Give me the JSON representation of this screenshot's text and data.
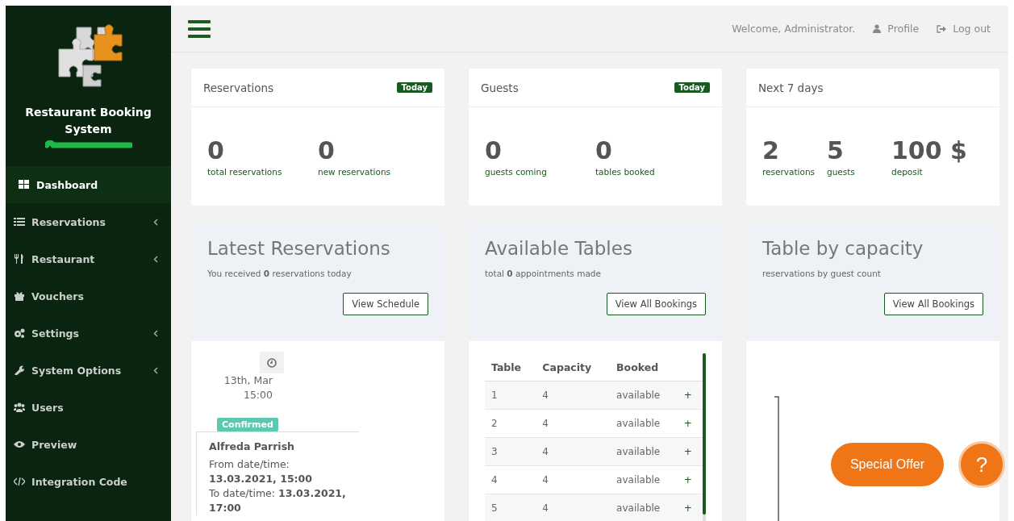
{
  "sidebar": {
    "title": "Restaurant Booking System",
    "items": [
      {
        "label": "Dashboard",
        "selected": true,
        "submenu": false
      },
      {
        "label": "Reservations",
        "selected": false,
        "submenu": true
      },
      {
        "label": "Restaurant",
        "selected": false,
        "submenu": true
      },
      {
        "label": "Vouchers",
        "selected": false,
        "submenu": false
      },
      {
        "label": "Settings",
        "selected": false,
        "submenu": true
      },
      {
        "label": "System Options",
        "selected": false,
        "submenu": true
      },
      {
        "label": "Users",
        "selected": false,
        "submenu": false
      },
      {
        "label": "Preview",
        "selected": false,
        "submenu": false
      },
      {
        "label": "Integration Code",
        "selected": false,
        "submenu": false
      }
    ]
  },
  "topbar": {
    "welcome": "Welcome, Administrator.",
    "links": [
      {
        "label": "Profile"
      },
      {
        "label": "Log out"
      }
    ]
  },
  "stat_cards": [
    {
      "title": "Reservations",
      "badge": "Today",
      "stats": [
        {
          "value": "0",
          "label": "total reservations"
        },
        {
          "value": "0",
          "label": "new reservations"
        }
      ]
    },
    {
      "title": "Guests",
      "badge": "Today",
      "stats": [
        {
          "value": "0",
          "label": "guests coming"
        },
        {
          "value": "0",
          "label": "tables booked"
        }
      ]
    },
    {
      "title": "Next 7 days",
      "stats": [
        {
          "value": "2",
          "label": "reservations"
        },
        {
          "value": "5",
          "label": "guests"
        },
        {
          "value": "100 $",
          "label": "deposit"
        }
      ]
    }
  ],
  "panels": [
    {
      "kind": "timeline",
      "title": "Latest Reservations",
      "subtitle": "You received **0** reservations today",
      "button": "View Schedule"
    },
    {
      "kind": "tables",
      "title": "Available Tables",
      "subtitle": "total **0** appointments made",
      "button": "View All Bookings"
    },
    {
      "kind": "chart",
      "title": "Table by capacity",
      "subtitle": "reservations by guest count",
      "button": "View All Bookings"
    }
  ],
  "timeline": {
    "date": "13th, Mar",
    "time": "15:00",
    "status": "Confirmed",
    "name": "Alfreda Parrish",
    "lines": [
      "From date/time: **13.03.2021, 15:00**",
      "To date/time: **13.03.2021, 17:00**"
    ]
  },
  "tables": {
    "columns": [
      "Table",
      "Capacity",
      "Booked"
    ],
    "rows": [
      {
        "table": "1",
        "capacity": "4",
        "booked": "available",
        "action": "+"
      },
      {
        "table": "2",
        "capacity": "4",
        "booked": "available",
        "action": "+"
      },
      {
        "table": "3",
        "capacity": "4",
        "booked": "available",
        "action": "+"
      },
      {
        "table": "4",
        "capacity": "4",
        "booked": "available",
        "action": "+"
      },
      {
        "table": "5",
        "capacity": "4",
        "booked": "available",
        "action": "+"
      }
    ]
  },
  "special_offer": "Special Offer",
  "help": "?"
}
